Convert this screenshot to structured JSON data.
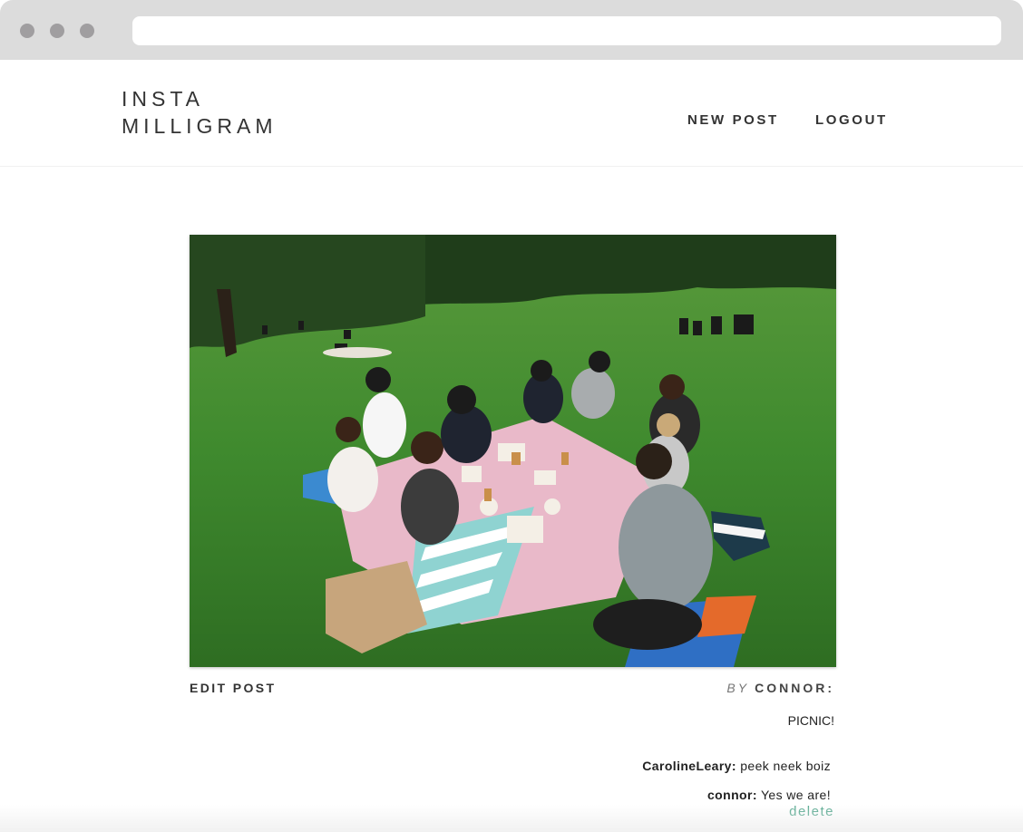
{
  "browser": {
    "url": ""
  },
  "header": {
    "logo_line1": "INSTA",
    "logo_line2": "MILLIGRAM",
    "nav": {
      "new_post": "NEW POST",
      "logout": "LOGOUT"
    }
  },
  "post": {
    "image_alt": "Group of friends having a picnic on a lawn",
    "edit_label": "EDIT POST",
    "by_label": "BY",
    "author": "CONNOR:",
    "caption": "PICNIC!",
    "comments": [
      {
        "user": "CarolineLeary:",
        "text": "peek neek boiz"
      },
      {
        "user": "connor:",
        "text": "Yes we are!"
      }
    ],
    "delete_label": "delete"
  },
  "colors": {
    "accent": "#5aab92",
    "chrome": "#dcdcdc",
    "grass": "#3f8a2e"
  }
}
